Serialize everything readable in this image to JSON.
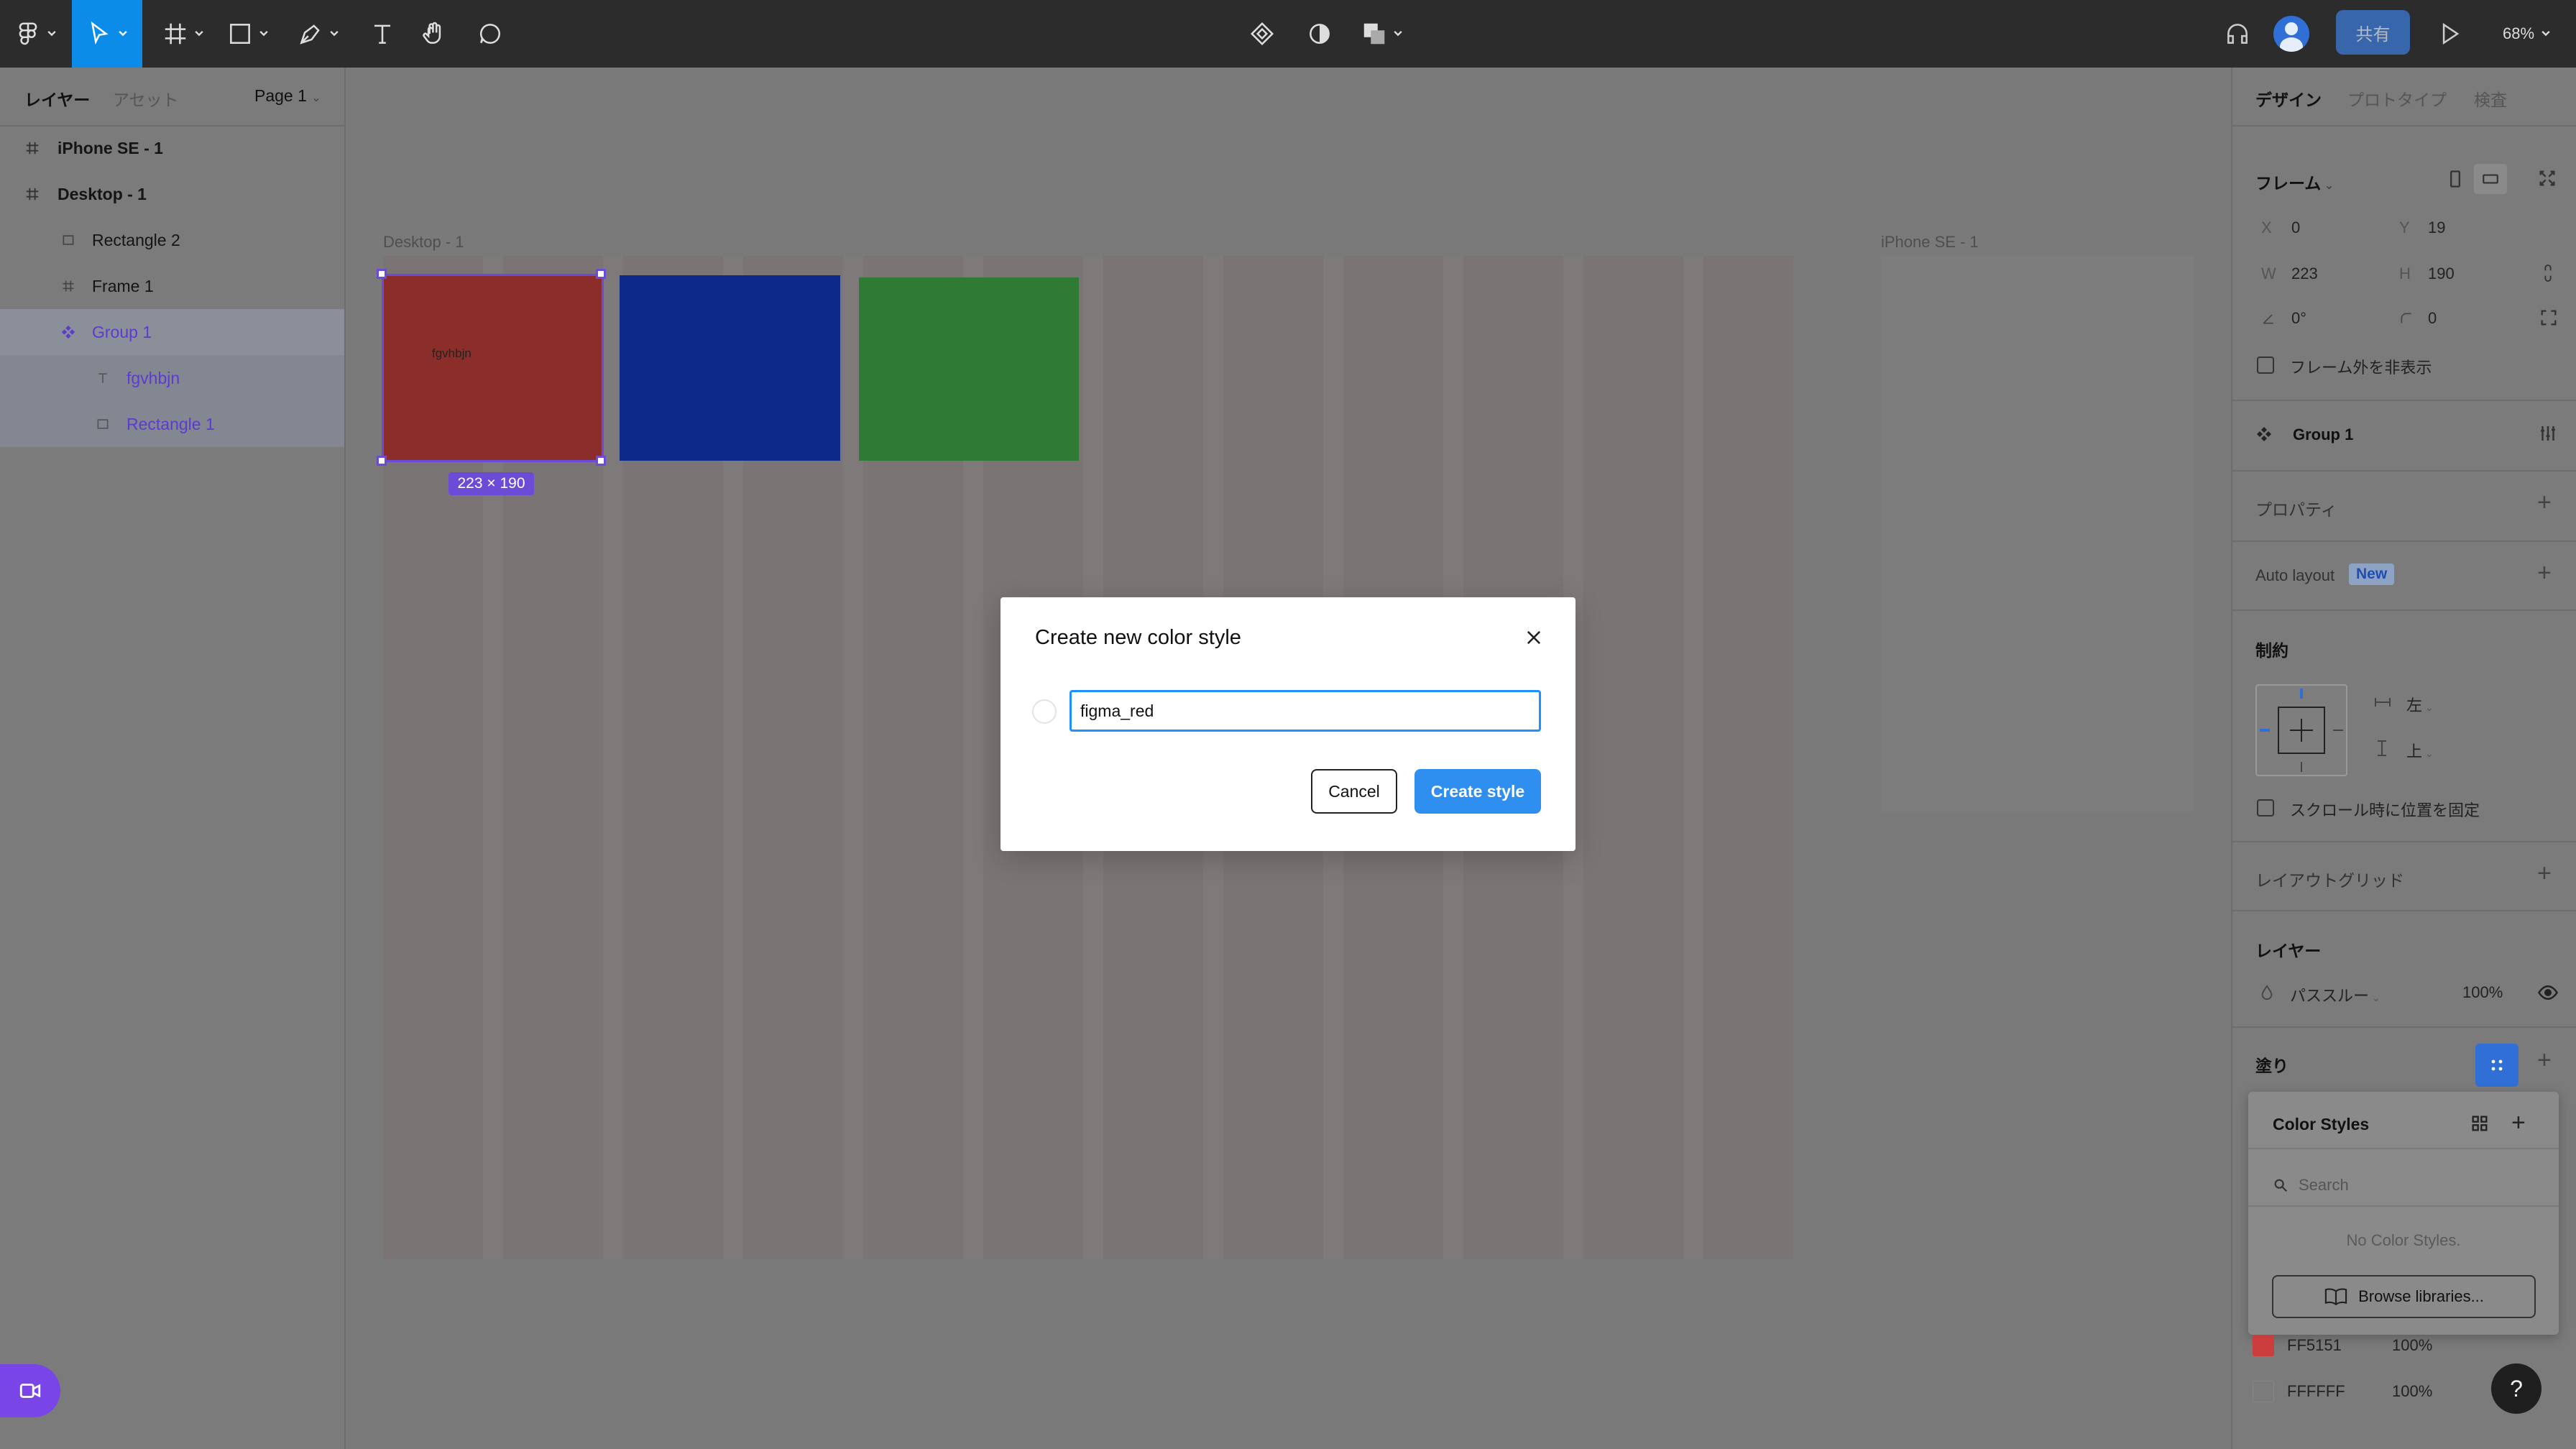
{
  "toolbar": {
    "share_label": "共有",
    "zoom_label": "68%",
    "icons": [
      "figma-menu-icon",
      "move-icon",
      "frame-icon",
      "shape-icon",
      "pen-icon",
      "text-icon",
      "hand-icon",
      "comment-icon",
      "component-icon",
      "mask-icon",
      "boolean-icon",
      "headphones-icon",
      "avatar",
      "play-icon"
    ]
  },
  "left_panel": {
    "tabs": {
      "layers": "レイヤー",
      "assets": "アセット"
    },
    "page": "Page 1",
    "layers": [
      {
        "name": "iPhone SE - 1",
        "icon": "frame-icon"
      },
      {
        "name": "Desktop - 1",
        "icon": "frame-icon"
      },
      {
        "name": "Rectangle 2",
        "icon": "rectangle-icon"
      },
      {
        "name": "Frame 1",
        "icon": "frame-icon"
      },
      {
        "name": "Group 1",
        "icon": "component-icon"
      },
      {
        "name": "fgvhbjn",
        "icon": "text-icon"
      },
      {
        "name": "Rectangle 1",
        "icon": "rectangle-icon"
      }
    ]
  },
  "canvas": {
    "desktop_label": "Desktop - 1",
    "iphone_label": "iPhone SE - 1",
    "size_badge": "223 × 190",
    "rect_text": "fgvhbjn",
    "colors": {
      "red": "#8b2e2a",
      "blue": "#0b2a8a",
      "green": "#2f7a34"
    }
  },
  "right_panel": {
    "tabs": {
      "design": "デザイン",
      "prototype": "プロトタイプ",
      "inspect": "検査"
    },
    "frame_title": "フレーム",
    "x_label": "X",
    "x_value": "0",
    "y_label": "Y",
    "y_value": "19",
    "w_label": "W",
    "w_value": "223",
    "h_label": "H",
    "h_value": "190",
    "rotation": "0°",
    "radius": "0",
    "clip_content": "フレーム外を非表示",
    "component_name": "Group 1",
    "properties": "プロパティ",
    "auto_layout": "Auto layout",
    "new_badge": "New",
    "constraints": "制約",
    "constraint_h": "左",
    "constraint_v": "上",
    "fix_scroll": "スクロール時に位置を固定",
    "layout_grid": "レイアウトグリッド",
    "layer_title": "レイヤー",
    "blend_mode": "パススルー",
    "opacity": "100%",
    "fill_title": "塗り",
    "color_styles": {
      "title": "Color Styles",
      "search_placeholder": "Search",
      "empty": "No Color Styles.",
      "browse": "Browse libraries..."
    },
    "swatches": [
      {
        "hex": "FF5151",
        "opacity": "100%",
        "color": "#cc3e3e"
      },
      {
        "hex": "FFFFFF",
        "opacity": "100%",
        "color": "#7b7b7b"
      }
    ],
    "help": "?"
  },
  "modal": {
    "title": "Create new color style",
    "input_value": "figma_red",
    "cancel": "Cancel",
    "create": "Create style"
  }
}
